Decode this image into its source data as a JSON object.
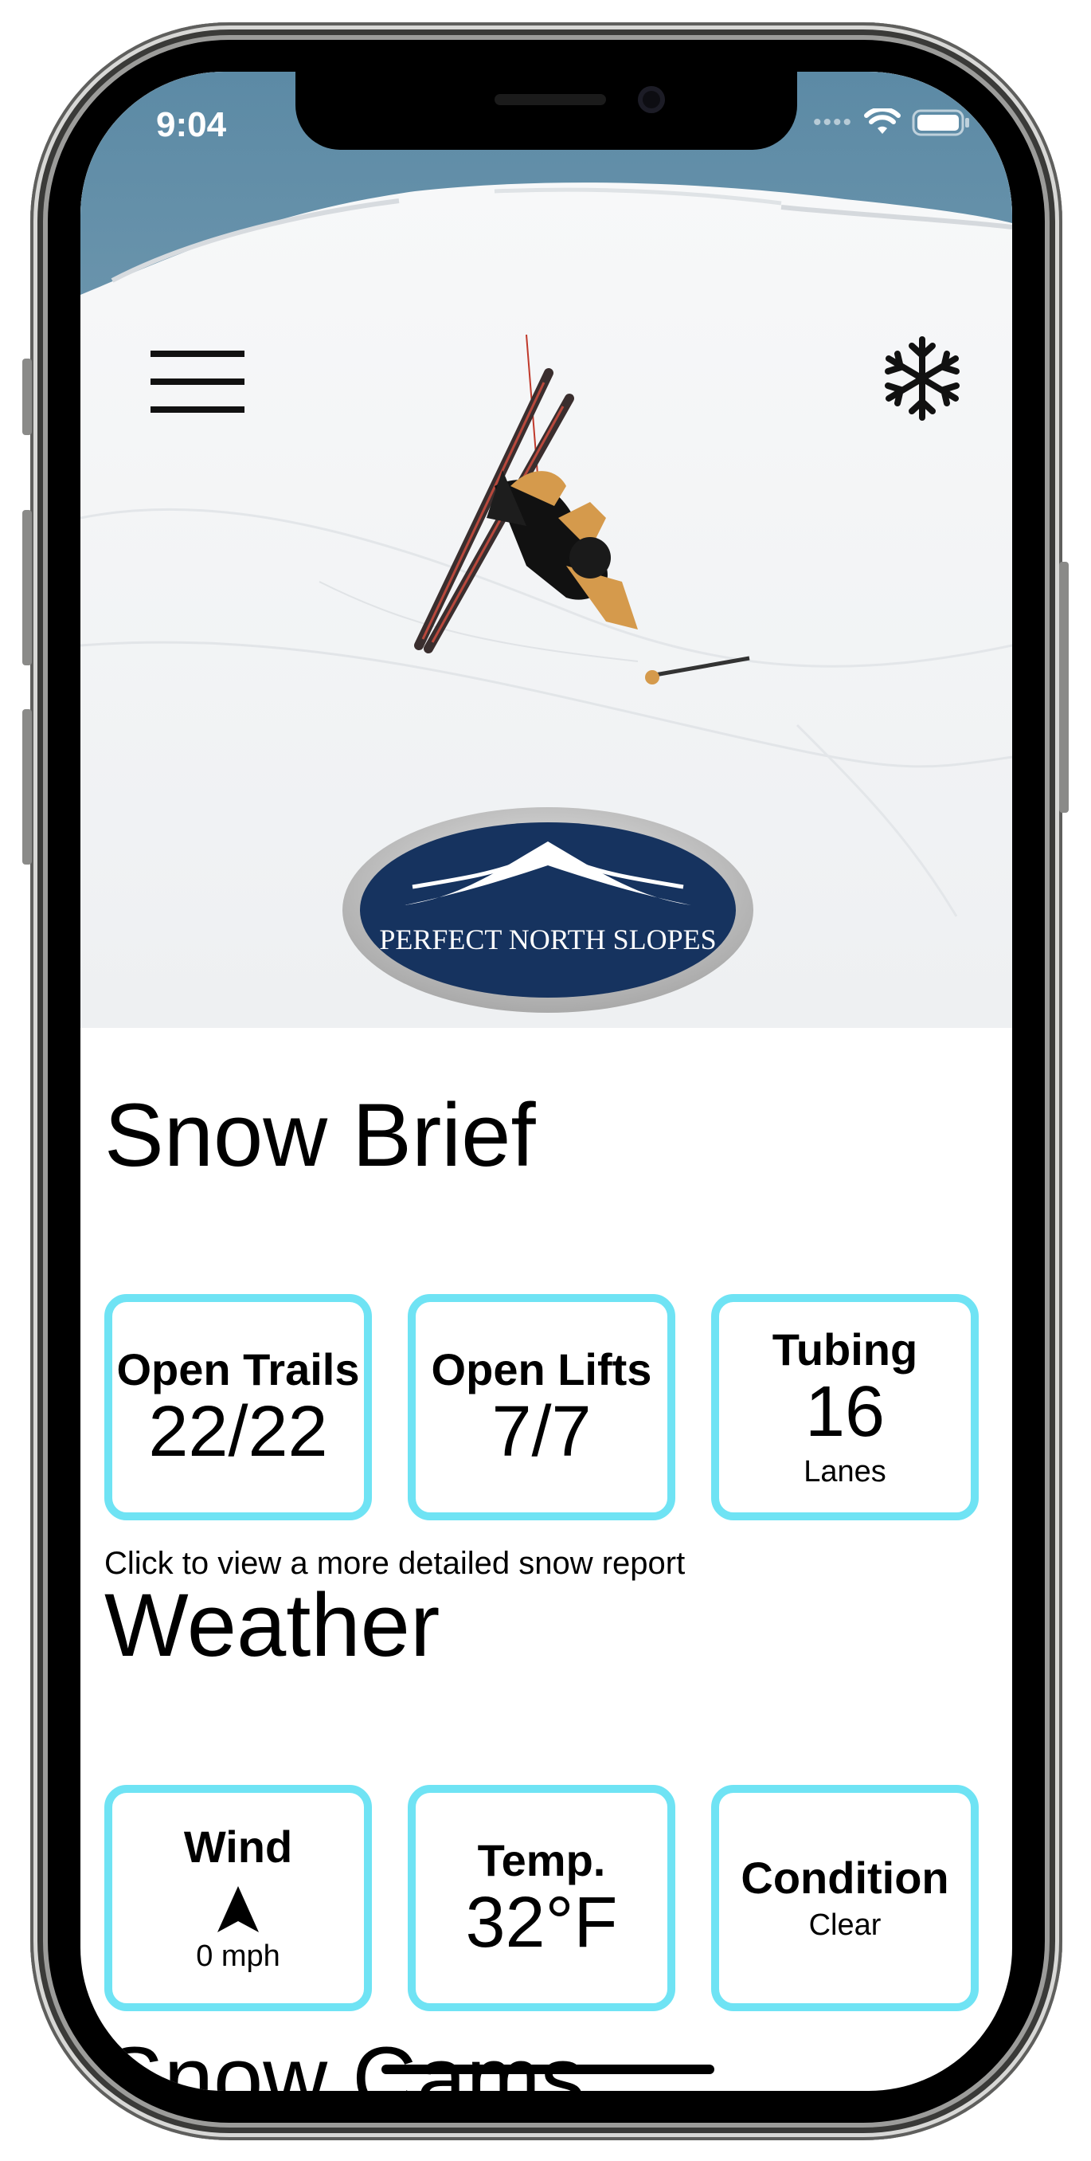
{
  "status_bar": {
    "time": "9:04"
  },
  "header": {
    "logo_text": "PERFECT NORTH SLOPES"
  },
  "snow_brief": {
    "title": "Snow Brief",
    "cards": [
      {
        "label": "Open Trails",
        "value": "22/22",
        "sub": ""
      },
      {
        "label": "Open Lifts",
        "value": "7/7",
        "sub": ""
      },
      {
        "label": "Tubing",
        "value": "16",
        "sub": "Lanes"
      }
    ],
    "hint": "Click to view a more detailed snow report"
  },
  "weather": {
    "title": "Weather",
    "wind": {
      "label": "Wind",
      "value": "0 mph"
    },
    "temp": {
      "label": "Temp.",
      "value": "32°F"
    },
    "condition": {
      "label": "Condition",
      "value": "Clear"
    }
  },
  "snow_cams": {
    "title": "Snow Cams"
  },
  "colors": {
    "card_border": "#6fe3f4",
    "logo_blue": "#16335f",
    "sky": "#5e8aa4"
  },
  "icons": {
    "menu": "hamburger-icon",
    "snow": "snowflake-icon",
    "wind": "navigation-arrow-icon"
  }
}
